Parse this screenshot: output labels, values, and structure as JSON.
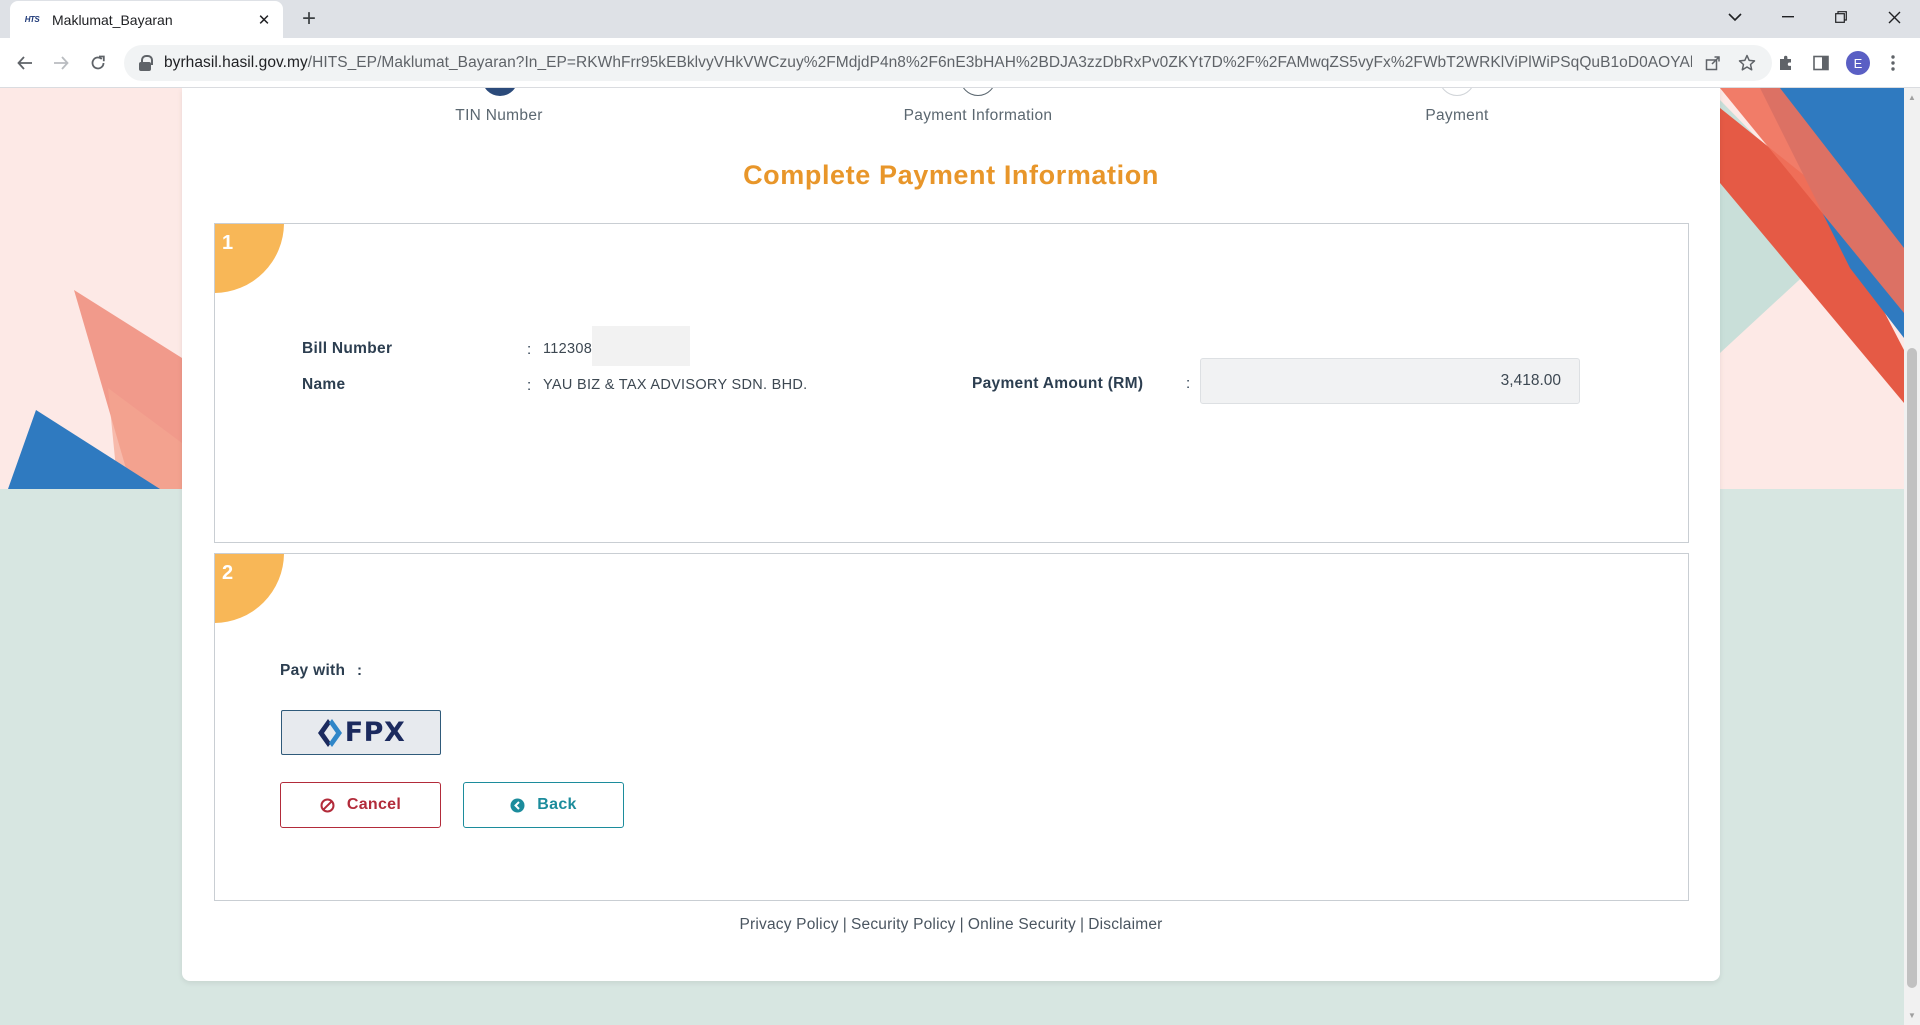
{
  "browser": {
    "tab_title": "Maklumat_Bayaran",
    "favicon_text": "HTS",
    "url_host": "byrhasil.hasil.gov.my",
    "url_path": "/HITS_EP/Maklumat_Bayaran?In_EP=RKWhFrr95kEBklvyVHkVWCzuy%2FMdjdP4n8%2F6nE3bHAH%2BDJA3zzDbRxPv0ZKYt7D%2F%2FAMwqZS5vyFx%2FWbT2WRKlViPlWiPSqQuB1oD0AOYAhW...",
    "profile_initial": "E"
  },
  "steps": [
    {
      "label": "TIN Number",
      "state": "completed",
      "color": "#2b4a7a"
    },
    {
      "label": "Payment Information",
      "state": "current",
      "color": "#ffffff"
    },
    {
      "label": "Payment",
      "state": "pending",
      "color": "#ffffff"
    }
  ],
  "page_title": "Complete Payment Information",
  "section1": {
    "number": "1",
    "bill_number_label": "Bill Number",
    "bill_number_value": "112308",
    "name_label": "Name",
    "name_value": "YAU BIZ & TAX ADVISORY SDN. BHD.",
    "amount_label": "Payment Amount (RM)",
    "amount_value": "3,418.00",
    "colon": ":"
  },
  "section2": {
    "number": "2",
    "pay_with_label": "Pay with",
    "colon": ":",
    "fpx_label": "FPX",
    "cancel_label": "Cancel",
    "back_label": "Back"
  },
  "footer": {
    "links": [
      "Privacy Policy",
      "Security Policy",
      "Online Security",
      "Disclaimer"
    ],
    "separator": "|"
  },
  "colors": {
    "title_orange": "#e8962a",
    "badge_orange": "#f8b757",
    "cancel_red": "#b22b3a",
    "back_teal": "#1c8c9c",
    "fpx_navy": "#1b2a5e"
  }
}
